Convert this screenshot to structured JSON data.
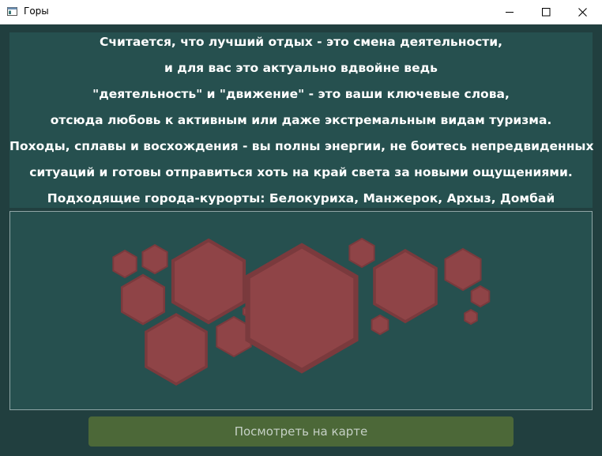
{
  "window": {
    "title": "Горы"
  },
  "description": {
    "lines": [
      "Считается, что лучший отдых - это смена деятельности,",
      "и для вас это актуально вдвойне ведь",
      "\"деятельность\" и \"движение\" - это ваши ключевые слова,",
      "отсюда любовь к активным или даже экстремальным видам туризма.",
      "Походы, сплавы и восхождения - вы полны энергии, не боитесь непредвиденных",
      "ситуаций и готовы отправиться хоть на край света за новыми ощущениями.",
      "Подходящие города-курорты: Белокуриха, Манжерок, Архыз, Домбай"
    ]
  },
  "image": {
    "icon": "hexagon-pattern",
    "hex_fill": "#8f4447",
    "hex_stroke": "#7a3a3d"
  },
  "actions": {
    "map_button_label": "Посмотреть на карте"
  },
  "colors": {
    "background": "#213f3f",
    "panel": "#26504f",
    "button": "#4c6838",
    "button_text": "#c5d0c5"
  }
}
